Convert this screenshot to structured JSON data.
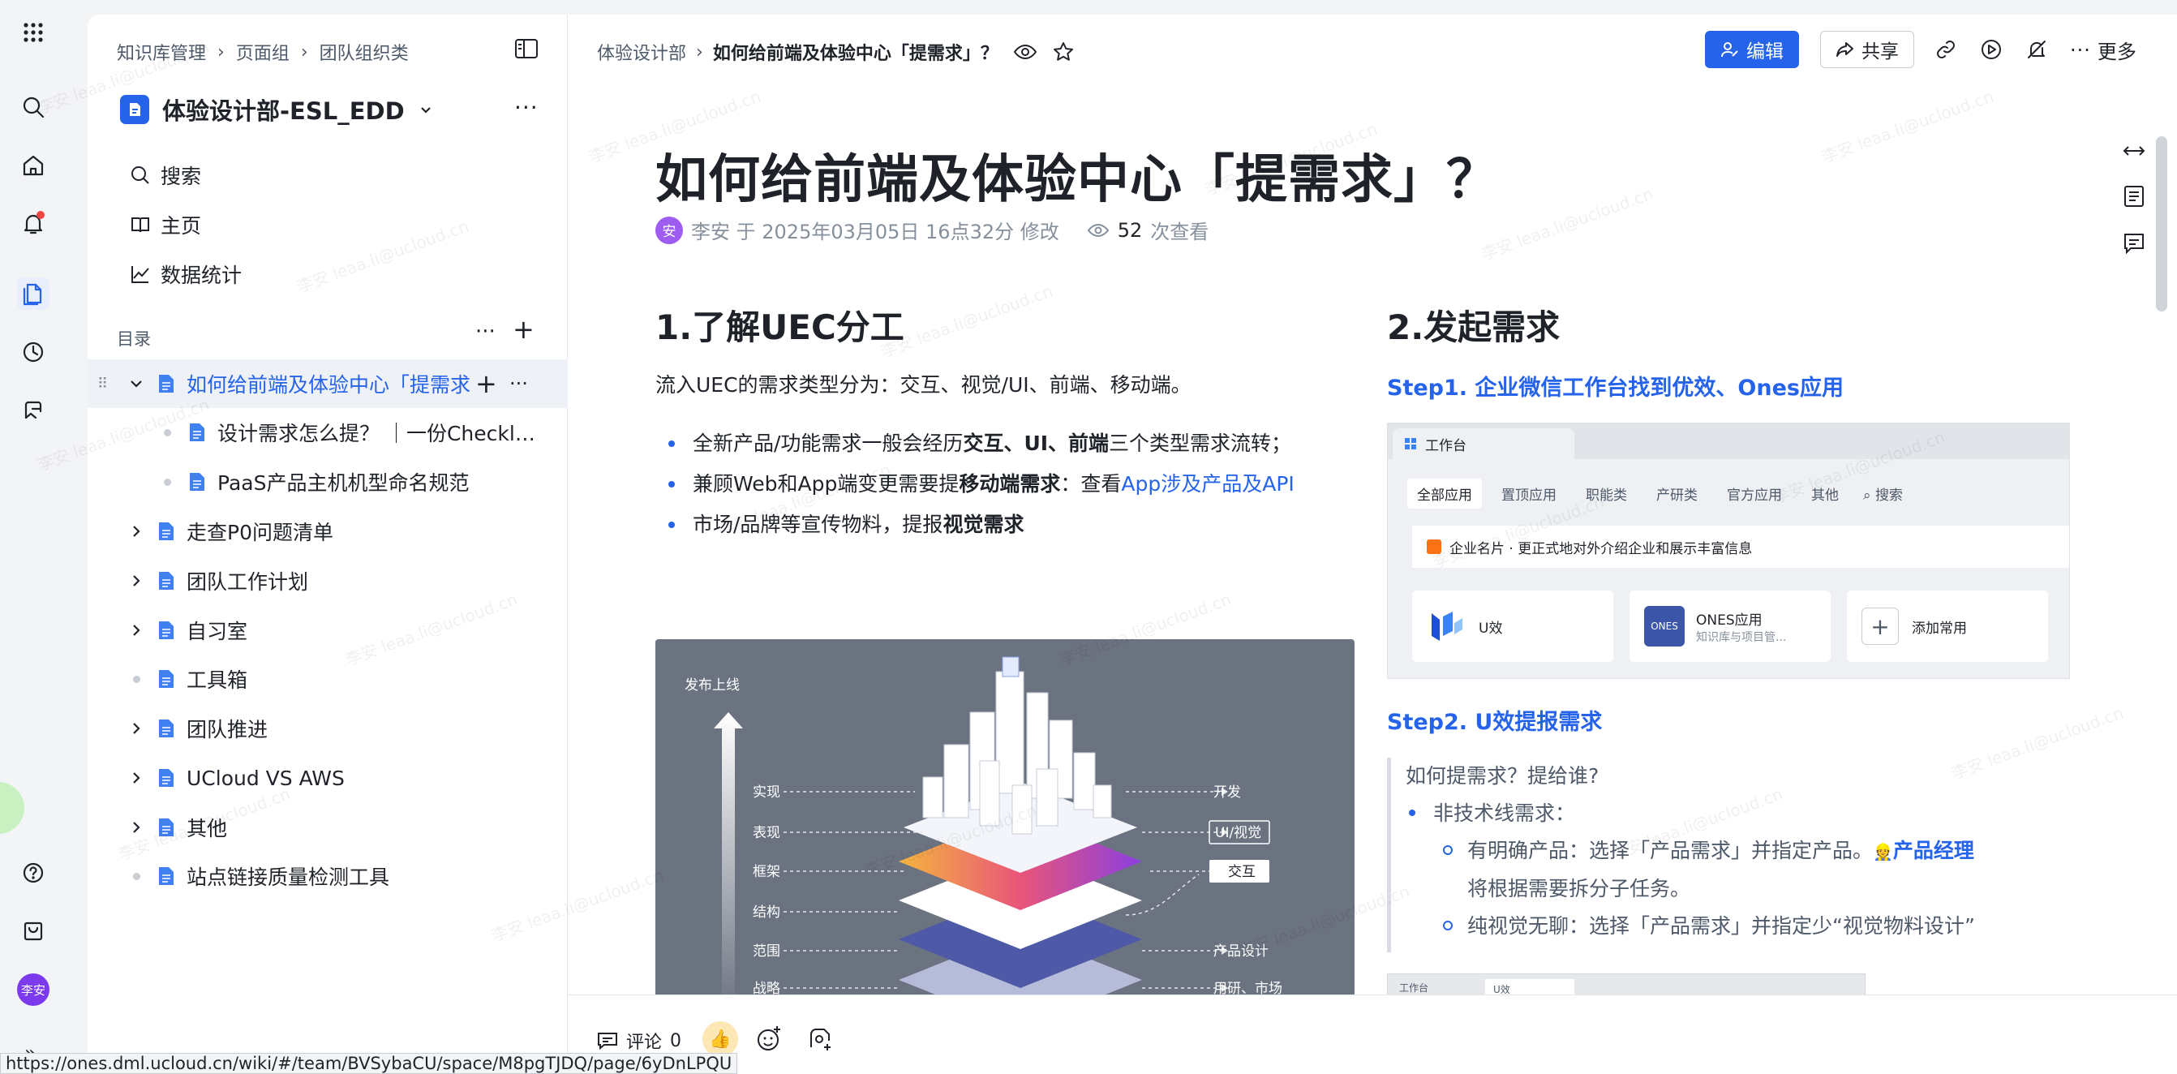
{
  "rail": {
    "avatar_text": "李安"
  },
  "tree": {
    "breadcrumb": [
      "知识库管理",
      "页面组",
      "团队组织类"
    ],
    "workspace_name": "体验设计部-ESL_EDD",
    "nav": {
      "search": "搜索",
      "home": "主页",
      "stats": "数据统计"
    },
    "section_label": "目录",
    "items": [
      {
        "label": "如何给前端及体验中心「提需求",
        "type": "expand",
        "selected": true
      },
      {
        "label": "设计需求怎么提？ ｜一份Checkli...",
        "type": "dot",
        "child": true
      },
      {
        "label": "PaaS产品主机机型命名规范",
        "type": "dot",
        "child": true
      },
      {
        "label": "走查P0问题清单",
        "type": "arrow"
      },
      {
        "label": "团队工作计划",
        "type": "arrow"
      },
      {
        "label": "自习室",
        "type": "arrow"
      },
      {
        "label": "工具箱",
        "type": "dot"
      },
      {
        "label": "团队推进",
        "type": "arrow"
      },
      {
        "label": "UCloud VS AWS",
        "type": "arrow"
      },
      {
        "label": "其他",
        "type": "arrow"
      },
      {
        "label": "站点链接质量检测工具",
        "type": "dot"
      }
    ]
  },
  "header": {
    "crumb_parent": "体验设计部",
    "crumb_current": "如何给前端及体验中心「提需求」？",
    "edit_label": "编辑",
    "share_label": "共享",
    "more_label": "更多"
  },
  "doc": {
    "title": "如何给前端及体验中心「提需求」？",
    "author_avatar": "安",
    "meta": "李安 于 2025年03月05日 16点32分 修改",
    "views": "52",
    "views_suffix": "次查看",
    "left": {
      "heading": "1.了解UEC分工",
      "intro": "流入UEC的需求类型分为：交互、视觉/UI、前端、移动端。",
      "b1_a": "全新产品/功能需求一般会经历",
      "b1_b": "交互、UI、前端",
      "b1_c": "三个类型需求流转；",
      "b2_a": "兼顾Web和App端变更需要提",
      "b2_b": "移动端需求",
      "b2_c": "：查看",
      "b2_link": "App涉及产品及API",
      "b3_a": "市场/品牌等宣传物料，提报",
      "b3_b": "视觉需求"
    },
    "diagram": {
      "release": "发布上线",
      "left_labels": [
        "实现",
        "表现",
        "框架",
        "结构",
        "范围",
        "战略"
      ],
      "right_labels": [
        "开发",
        "UI/视觉",
        "交互",
        "产品设计",
        "用研、市场"
      ]
    },
    "right": {
      "heading": "2.发起需求",
      "step1": "Step1. 企业微信工作台找到优效、Ones应用",
      "shot": {
        "tab": "工作台",
        "filters": [
          "全部应用",
          "置顶应用",
          "职能类",
          "产研类",
          "官方应用",
          "其他"
        ],
        "search": "搜索",
        "banner": "企业名片 · 更正式地对外介绍企业和展示丰富信息",
        "app1": "U效",
        "app2": "ONES应用",
        "app2_sub": "知识库与项目管...",
        "app3": "添加常用",
        "ones_logo": "ONES"
      },
      "step2": "Step2. U效提报需求",
      "q_title": "如何提需求？提给谁?",
      "q_b1": "非技术线需求：",
      "q_c1_a": "有明确产品：选择「产品需求」并指定产品。",
      "q_c1_link": "产品经理",
      "q_c1_b": "将根据需要拆分子任务。",
      "q_c2": "纯视觉无聊：选择「产品需求」并指定少“视觉物料设计”",
      "mini_tab1": "工作台",
      "mini_tab2": "U效"
    }
  },
  "footer": {
    "comments": "评论",
    "comment_count": "0"
  },
  "statusbar": {
    "url": "https://ones.dml.ucloud.cn/wiki/#/team/BVSybaCU/space/M8pgTJDQ/page/6yDnLPQU"
  },
  "watermark": "李安 leaa.li@ucloud.cn",
  "colors": {
    "accent": "#2563eb",
    "badge": "#ef4444"
  }
}
